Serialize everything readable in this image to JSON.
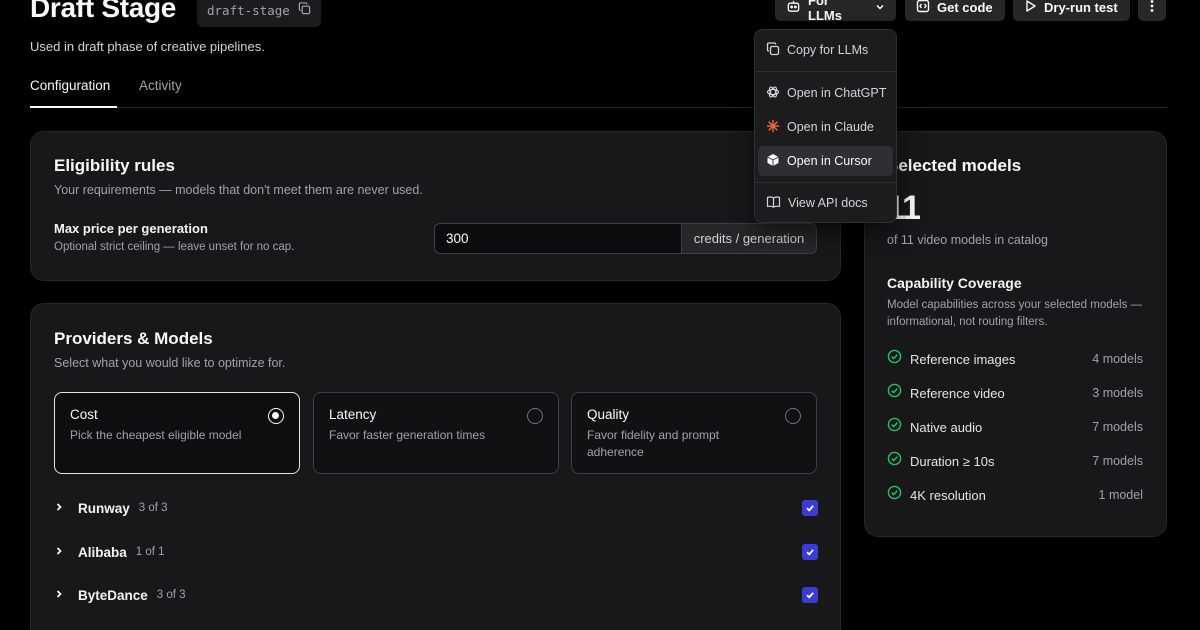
{
  "header": {
    "title": "Draft Stage",
    "slug": "draft-stage",
    "subtitle": "Used in draft phase of creative pipelines.",
    "for_llms_label": "For LLMs",
    "get_code_label": "Get code",
    "dry_run_label": "Dry-run test"
  },
  "tabs": [
    {
      "label": "Configuration",
      "active": true
    },
    {
      "label": "Activity",
      "active": false
    }
  ],
  "eligibility": {
    "title": "Eligibility rules",
    "subtitle": "Your requirements — models that don't meet them are never used.",
    "max_price_label": "Max price per generation",
    "max_price_hint": "Optional strict ceiling — leave unset for no cap.",
    "max_price_value": "300",
    "max_price_unit": "credits / generation"
  },
  "providers_models": {
    "title": "Providers & Models",
    "subtitle": "Select what you would like to optimize for.",
    "options": [
      {
        "title": "Cost",
        "desc": "Pick the cheapest eligible model",
        "selected": true
      },
      {
        "title": "Latency",
        "desc": "Favor faster generation times",
        "selected": false
      },
      {
        "title": "Quality",
        "desc": "Favor fidelity and prompt adherence",
        "selected": false
      }
    ],
    "providers": [
      {
        "name": "Runway",
        "count": "3 of 3",
        "checked": true
      },
      {
        "name": "Alibaba",
        "count": "1 of 1",
        "checked": true
      },
      {
        "name": "ByteDance",
        "count": "3 of 3",
        "checked": true
      }
    ]
  },
  "selected_models": {
    "title": "Selected models",
    "count": "11",
    "count_sub": "of 11 video models in catalog",
    "capability_title": "Capability Coverage",
    "capability_sub": "Model capabilities across your selected models — informational, not routing filters.",
    "capabilities": [
      {
        "label": "Reference images",
        "count": "4 models"
      },
      {
        "label": "Reference video",
        "count": "3 models"
      },
      {
        "label": "Native audio",
        "count": "7 models"
      },
      {
        "label": "Duration ≥ 10s",
        "count": "7 models"
      },
      {
        "label": "4K resolution",
        "count": "1 model"
      }
    ]
  },
  "llm_menu": {
    "items": [
      {
        "label": "Copy for LLMs",
        "icon": "copy-icon"
      },
      {
        "label": "Open in ChatGPT",
        "icon": "chatgpt-icon"
      },
      {
        "label": "Open in Claude",
        "icon": "claude-icon"
      },
      {
        "label": "Open in Cursor",
        "icon": "cursor-icon"
      },
      {
        "label": "View API docs",
        "icon": "book-icon"
      }
    ]
  },
  "colors": {
    "background": "#000000",
    "card": "#18181b",
    "accent_checkbox": "#3b3bd6",
    "check_green": "#22c55e",
    "claude_orange": "#e8623c"
  }
}
